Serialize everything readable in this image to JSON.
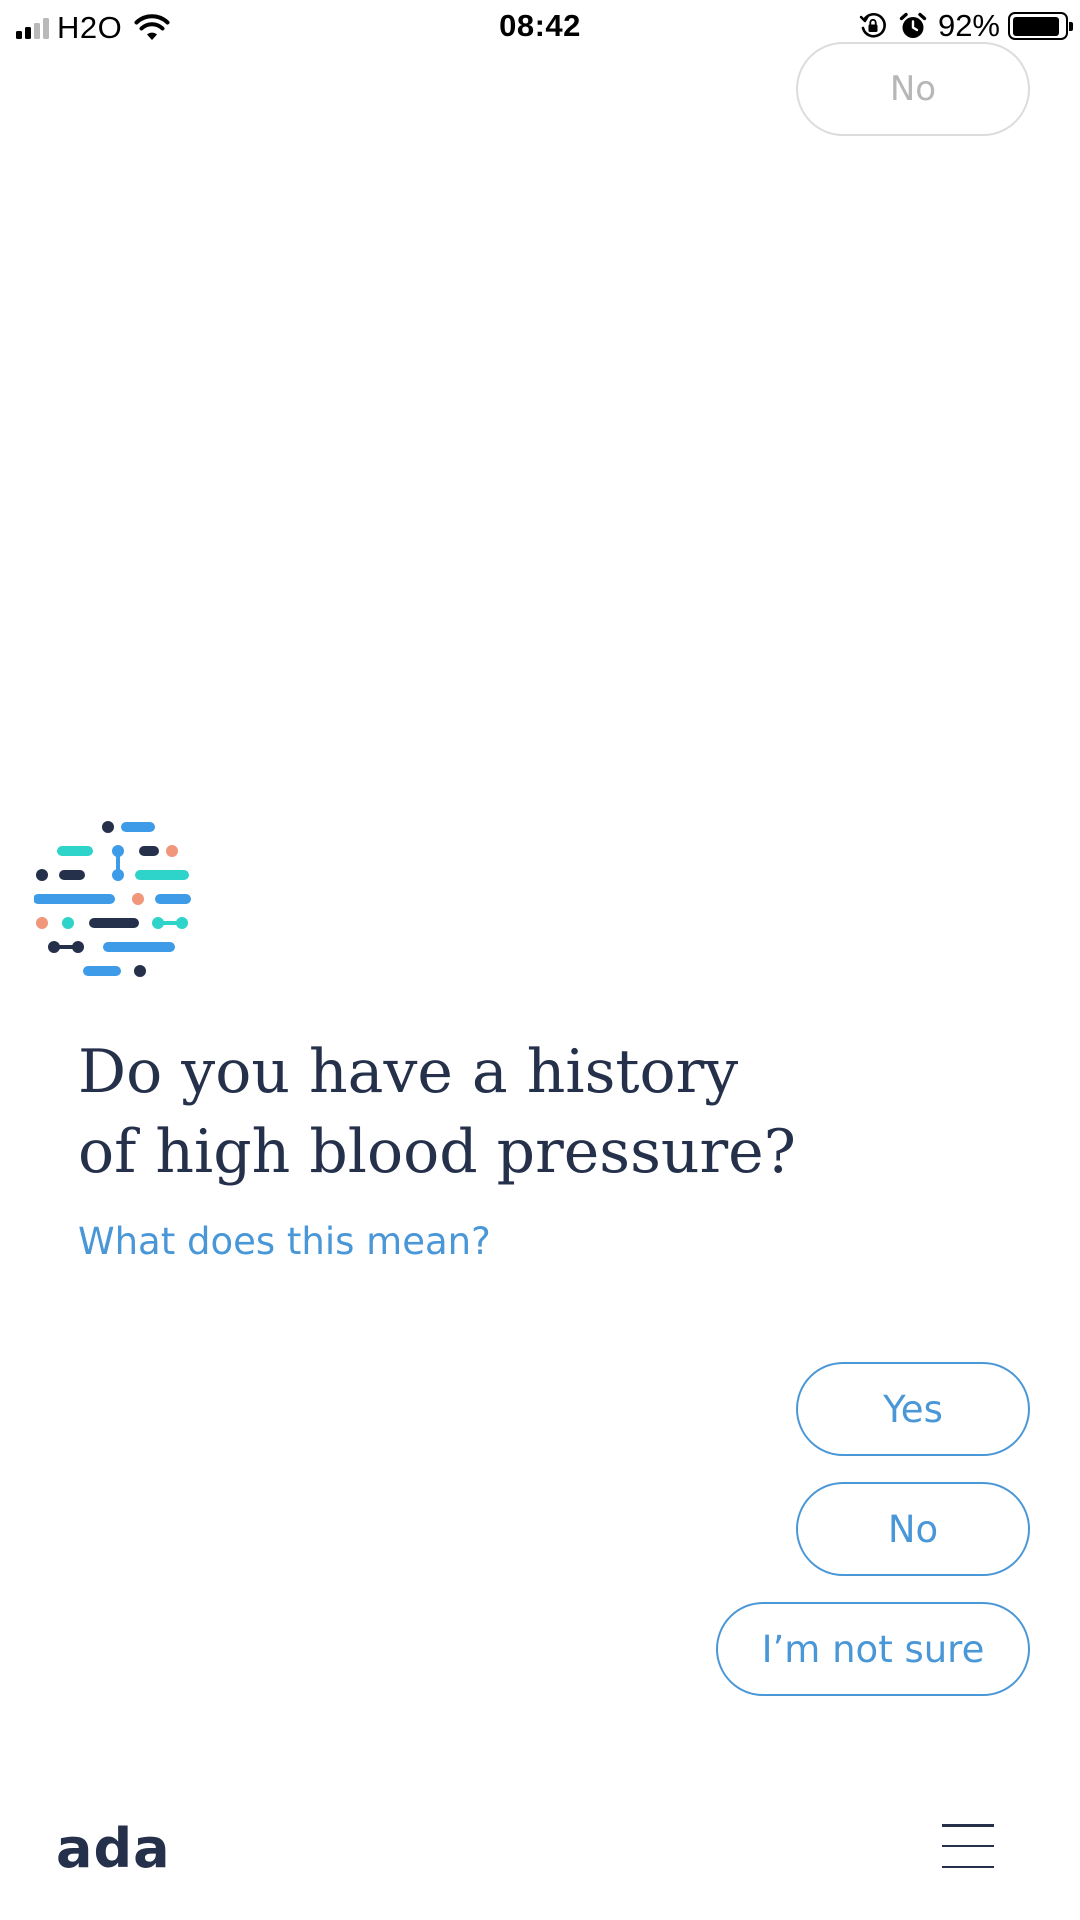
{
  "status_bar": {
    "carrier": "H2O",
    "time": "08:42",
    "battery_percent": "92%",
    "battery_level": 0.92,
    "signal_bars": 2,
    "icons": [
      "signal-icon",
      "wifi-icon",
      "orientation-lock-icon",
      "alarm-icon",
      "battery-icon"
    ]
  },
  "previous_answer": {
    "label": "No"
  },
  "question": {
    "line1": "Do you have a history",
    "line2": "of high blood pressure?",
    "help_link": "What does this mean?"
  },
  "answers": [
    {
      "label": "Yes"
    },
    {
      "label": "No"
    },
    {
      "label": "I’m not sure"
    }
  ],
  "footer": {
    "brand": "ada",
    "menu_icon": "hamburger-menu-icon"
  },
  "colors": {
    "accent_blue": "#4a97d8",
    "text_navy": "#25304b",
    "teal": "#2ed3c9",
    "light_blue": "#3e9be8",
    "salmon": "#f0967a",
    "faded_border": "#dcdcdc",
    "faded_text": "#b7b7b7"
  }
}
